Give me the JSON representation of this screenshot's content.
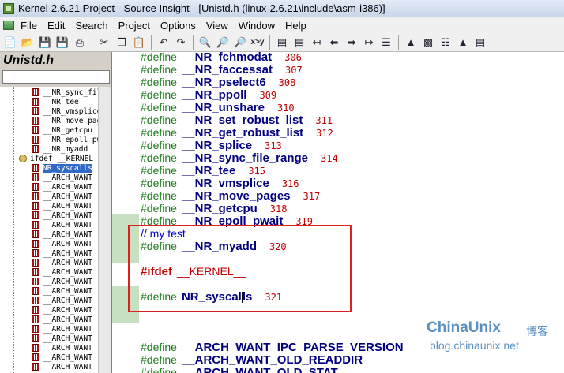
{
  "window": {
    "title": "Kernel-2.6.21 Project - Source Insight - [Unistd.h (linux-2.6.21\\include\\asm-i386)]"
  },
  "menu": [
    "File",
    "Edit",
    "Search",
    "Project",
    "Options",
    "View",
    "Window",
    "Help"
  ],
  "toolbar": {
    "icons": [
      "new-file-icon",
      "open-file-icon",
      "save-icon",
      "save-all-icon",
      "print-icon",
      "cut-icon",
      "copy-icon",
      "paste-icon",
      "undo-icon",
      "redo-icon",
      "find-icon",
      "find-prev-icon",
      "find-next-icon",
      "replace-icon",
      "bookmark-prev-icon",
      "bookmark-next-icon",
      "jump-prev-icon",
      "jump-back-icon",
      "jump-forward-icon",
      "jump-next-icon",
      "symbol-window-icon",
      "browse-icon",
      "relation-icon",
      "references-icon",
      "project-icon"
    ],
    "replace_label": "x>y"
  },
  "symbol_panel": {
    "title": "Unistd.h",
    "search_value": "",
    "items": [
      {
        "label": "__NR_sync_file",
        "type": "define"
      },
      {
        "label": "__NR_tee",
        "type": "define"
      },
      {
        "label": "__NR_vmsplice",
        "type": "define"
      },
      {
        "label": "__NR_move_page",
        "type": "define"
      },
      {
        "label": "__NR_getcpu",
        "type": "define"
      },
      {
        "label": "__NR_epoll_pwa",
        "type": "define"
      },
      {
        "label": "__NR_myadd",
        "type": "define"
      },
      {
        "label": "ifdef __KERNEL",
        "type": "conditional"
      },
      {
        "label": "NR_syscalls",
        "type": "define",
        "selected": true
      },
      {
        "label": "__ARCH_WANT",
        "type": "define"
      },
      {
        "label": "__ARCH_WANT",
        "type": "define"
      },
      {
        "label": "__ARCH_WANT",
        "type": "define"
      },
      {
        "label": "__ARCH_WANT",
        "type": "define"
      },
      {
        "label": "__ARCH_WANT",
        "type": "define"
      },
      {
        "label": "__ARCH_WANT",
        "type": "define"
      },
      {
        "label": "__ARCH_WANT",
        "type": "define"
      },
      {
        "label": "__ARCH_WANT",
        "type": "define"
      },
      {
        "label": "__ARCH_WANT",
        "type": "define"
      },
      {
        "label": "__ARCH_WANT",
        "type": "define"
      },
      {
        "label": "__ARCH_WANT",
        "type": "define"
      },
      {
        "label": "__ARCH_WANT",
        "type": "define"
      },
      {
        "label": "__ARCH_WANT",
        "type": "define"
      },
      {
        "label": "__ARCH_WANT",
        "type": "define"
      },
      {
        "label": "__ARCH_WANT",
        "type": "define"
      },
      {
        "label": "__ARCH_WANT",
        "type": "define"
      },
      {
        "label": "__ARCH_WANT",
        "type": "define"
      },
      {
        "label": "__ARCH_WANT",
        "type": "define"
      },
      {
        "label": "__ARCH_WANT",
        "type": "define"
      },
      {
        "label": "__ARCH_WANT",
        "type": "define"
      },
      {
        "label": "__ARCH_WANT",
        "type": "define"
      }
    ]
  },
  "code_lines": [
    {
      "kind": "define",
      "keyword": "#define",
      "name": "__NR_fchmodat",
      "value": "306"
    },
    {
      "kind": "define",
      "keyword": "#define",
      "name": "__NR_faccessat",
      "value": "307"
    },
    {
      "kind": "define",
      "keyword": "#define",
      "name": "__NR_pselect6",
      "value": "308"
    },
    {
      "kind": "define",
      "keyword": "#define",
      "name": "__NR_ppoll",
      "value": "309"
    },
    {
      "kind": "define",
      "keyword": "#define",
      "name": "__NR_unshare",
      "value": "310"
    },
    {
      "kind": "define",
      "keyword": "#define",
      "name": "__NR_set_robust_list",
      "value": "311"
    },
    {
      "kind": "define",
      "keyword": "#define",
      "name": "__NR_get_robust_list",
      "value": "312"
    },
    {
      "kind": "define",
      "keyword": "#define",
      "name": "__NR_splice",
      "value": "313"
    },
    {
      "kind": "define",
      "keyword": "#define",
      "name": "__NR_sync_file_range",
      "value": "314"
    },
    {
      "kind": "define",
      "keyword": "#define",
      "name": "__NR_tee",
      "value": "315"
    },
    {
      "kind": "define",
      "keyword": "#define",
      "name": "__NR_vmsplice",
      "value": "316"
    },
    {
      "kind": "define",
      "keyword": "#define",
      "name": "__NR_move_pages",
      "value": "317"
    },
    {
      "kind": "define",
      "keyword": "#define",
      "name": "__NR_getcpu",
      "value": "318"
    },
    {
      "kind": "define",
      "keyword": "#define",
      "name": "__NR_epoll_pwait",
      "value": "319"
    },
    {
      "kind": "comment",
      "text": "// my test"
    },
    {
      "kind": "define",
      "keyword": "#define",
      "name": "__NR_myadd",
      "value": "320"
    },
    {
      "kind": "blank"
    },
    {
      "kind": "ifdef",
      "keyword": "#ifdef",
      "macro": "__KERNEL__"
    },
    {
      "kind": "blank"
    },
    {
      "kind": "define",
      "keyword": "#define",
      "name": "NR_syscalls",
      "value": "321",
      "caret": true
    },
    {
      "kind": "blank"
    },
    {
      "kind": "blank"
    },
    {
      "kind": "blank"
    },
    {
      "kind": "define",
      "keyword": "#define",
      "name": "__ARCH_WANT_IPC_PARSE_VERSION",
      "value": ""
    },
    {
      "kind": "define",
      "keyword": "#define",
      "name": "__ARCH_WANT_OLD_READDIR",
      "value": ""
    },
    {
      "kind": "define",
      "keyword": "#define",
      "name": "__ARCH_WANT_OLD_STAT",
      "value": ""
    }
  ],
  "watermark": {
    "logo": "ChinaUnix",
    "logo_cn": "博客",
    "url": "blog.chinaunix.net"
  },
  "colors": {
    "keyword": "#1d7c1d",
    "symbol": "#000080",
    "number": "#c00000",
    "comment": "#0000c8",
    "highlight_box": "#e02020",
    "selection": "#3169c6"
  }
}
